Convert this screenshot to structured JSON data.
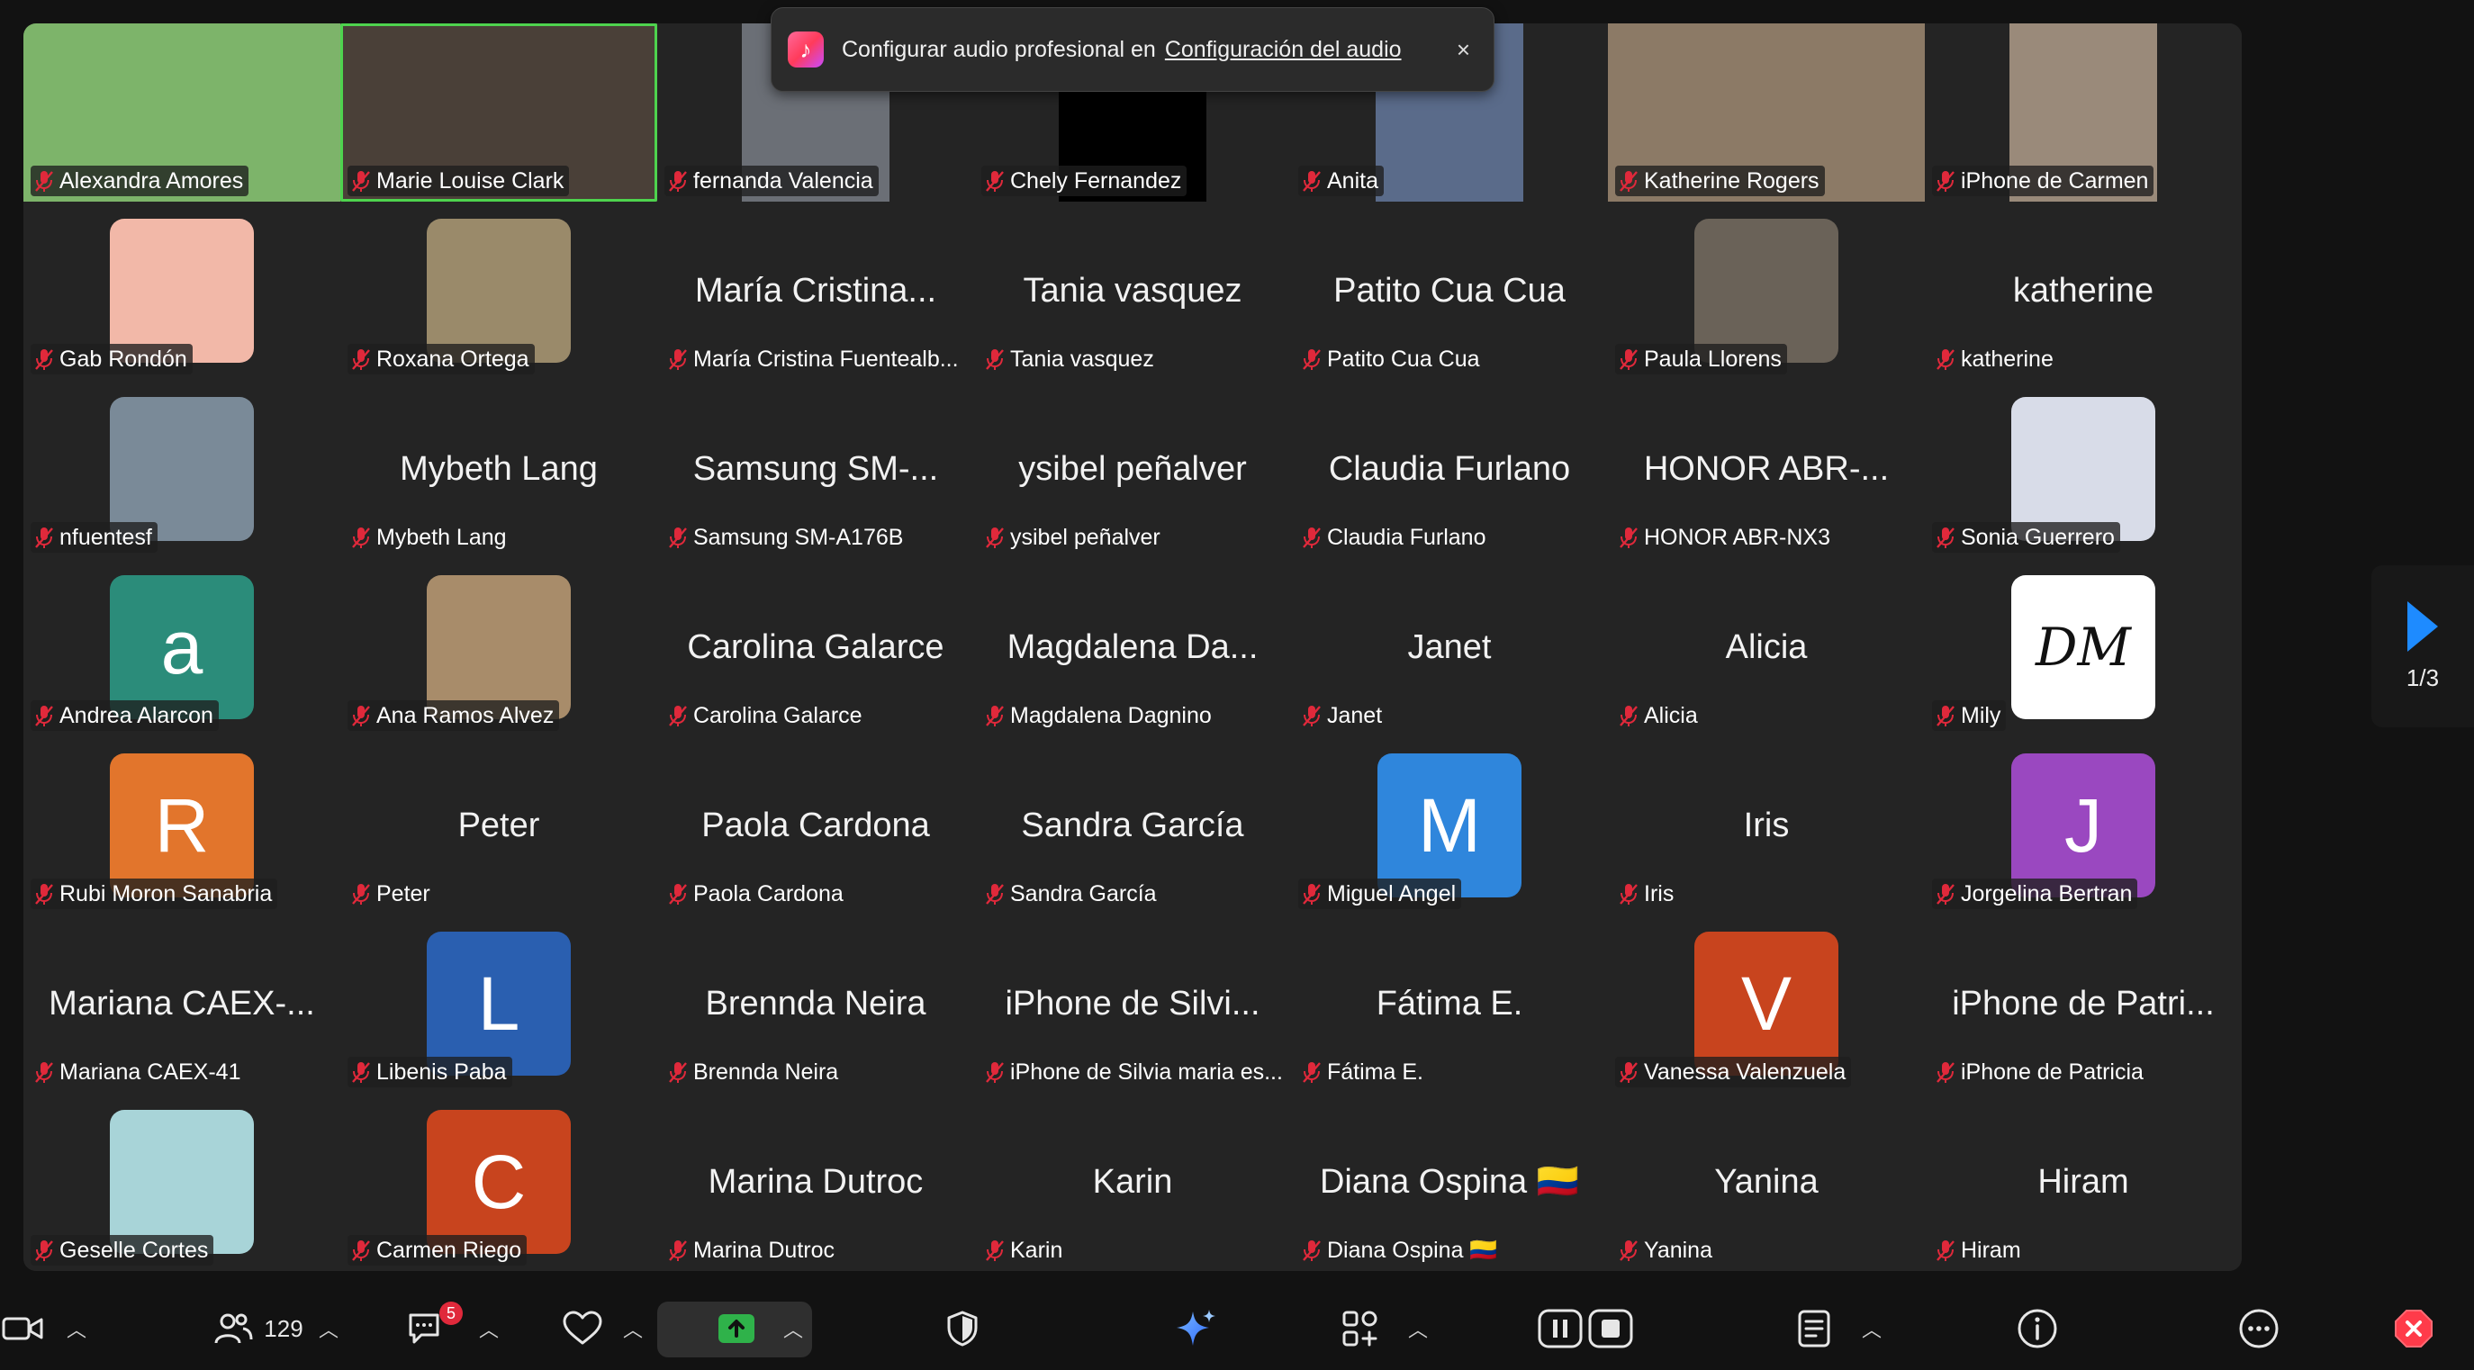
{
  "colors": {
    "background": "#121212",
    "grid": "#242424",
    "active_speaker_border": "#4ed34e",
    "mic_muted": "#e0293b",
    "accent_blue": "#1e8bff",
    "share_green": "#2fb24a"
  },
  "popup": {
    "text": "Configurar audio profesional en",
    "link": "Configuración del audio",
    "close": "×",
    "icon": "music-note-icon"
  },
  "pager": {
    "page": "1/3",
    "icon": "next-page-arrow-icon"
  },
  "participants": [
    {
      "label": "Alexandra Amores",
      "kind": "video",
      "bg": "#7db46a"
    },
    {
      "label": "Marie Louise Clark",
      "kind": "video",
      "bg": "#4a4038",
      "active": true
    },
    {
      "label": "fernanda Valencia",
      "kind": "video-small",
      "bg": "#6b6f76"
    },
    {
      "label": "Chely Fernandez",
      "kind": "video-small",
      "bg": "#000000"
    },
    {
      "label": "Anita",
      "kind": "video-small",
      "bg": "#5a6b8a"
    },
    {
      "label": "Katherine Rogers",
      "kind": "video",
      "bg": "#8c7a66"
    },
    {
      "label": "iPhone de Carmen",
      "kind": "video-small",
      "bg": "#9a8a7a"
    },
    {
      "label": "Gab Rondón",
      "kind": "avatar-photo",
      "bg": "#f2b8a8"
    },
    {
      "label": "Roxana Ortega",
      "kind": "avatar-photo",
      "bg": "#9a8a6a"
    },
    {
      "label": "María Cristina Fuentealb...",
      "kind": "name",
      "big": "María Cristina..."
    },
    {
      "label": "Tania vasquez",
      "kind": "name",
      "big": "Tania vasquez"
    },
    {
      "label": "Patito Cua Cua",
      "kind": "name",
      "big": "Patito Cua Cua"
    },
    {
      "label": "Paula Llorens",
      "kind": "avatar-photo",
      "bg": "#6a6258"
    },
    {
      "label": "katherine",
      "kind": "name",
      "big": "katherine"
    },
    {
      "label": "nfuentesf",
      "kind": "avatar-photo",
      "bg": "#7a8a98"
    },
    {
      "label": "Mybeth Lang",
      "kind": "name",
      "big": "Mybeth Lang"
    },
    {
      "label": "Samsung SM-A176B",
      "kind": "name",
      "big": "Samsung SM-..."
    },
    {
      "label": "ysibel peñalver",
      "kind": "name",
      "big": "ysibel peñalver"
    },
    {
      "label": "Claudia Furlano",
      "kind": "name",
      "big": "Claudia Furlano"
    },
    {
      "label": "HONOR ABR-NX3",
      "kind": "name",
      "big": "HONOR ABR-..."
    },
    {
      "label": "Sonia Guerrero",
      "kind": "avatar-photo",
      "bg": "#d8dce8"
    },
    {
      "label": "Andrea Alarcon",
      "kind": "avatar-letter",
      "letter": "a",
      "bg": "#2b8c7a"
    },
    {
      "label": "Ana Ramos Alvez",
      "kind": "avatar-photo",
      "bg": "#a88c6a"
    },
    {
      "label": "Carolina Galarce",
      "kind": "name",
      "big": "Carolina Galarce"
    },
    {
      "label": "Magdalena Dagnino",
      "kind": "name",
      "big": "Magdalena Da..."
    },
    {
      "label": "Janet",
      "kind": "name",
      "big": "Janet"
    },
    {
      "label": "Alicia",
      "kind": "name",
      "big": "Alicia"
    },
    {
      "label": "Mily",
      "kind": "avatar-logo",
      "letter": "DM",
      "bg": "#ffffff"
    },
    {
      "label": "Rubi Moron Sanabria",
      "kind": "avatar-letter",
      "letter": "R",
      "bg": "#e2752c"
    },
    {
      "label": "Peter",
      "kind": "name",
      "big": "Peter"
    },
    {
      "label": "Paola Cardona",
      "kind": "name",
      "big": "Paola Cardona"
    },
    {
      "label": "Sandra García",
      "kind": "name",
      "big": "Sandra García"
    },
    {
      "label": "Miguel Angel",
      "kind": "avatar-letter",
      "letter": "M",
      "bg": "#2f86dc"
    },
    {
      "label": "Iris",
      "kind": "name",
      "big": "Iris"
    },
    {
      "label": "Jorgelina Bertran",
      "kind": "avatar-letter",
      "letter": "J",
      "bg": "#9a48c0"
    },
    {
      "label": "Mariana CAEX-41",
      "kind": "name",
      "big": "Mariana CAEX-..."
    },
    {
      "label": "Libenis Paba",
      "kind": "avatar-letter",
      "letter": "L",
      "bg": "#2a5fb0"
    },
    {
      "label": "Brennda Neira",
      "kind": "name",
      "big": "Brennda Neira"
    },
    {
      "label": "iPhone de Silvia maria es...",
      "kind": "name",
      "big": "iPhone de Silvi..."
    },
    {
      "label": "Fátima E.",
      "kind": "name",
      "big": "Fátima E."
    },
    {
      "label": "Vanessa Valenzuela",
      "kind": "avatar-letter",
      "letter": "V",
      "bg": "#c8441e"
    },
    {
      "label": "iPhone de Patricia",
      "kind": "name",
      "big": "iPhone de Patri..."
    },
    {
      "label": "Geselle Cortes",
      "kind": "avatar-photo",
      "bg": "#a8d4d8"
    },
    {
      "label": "Carmen Riego",
      "kind": "avatar-letter",
      "letter": "C",
      "bg": "#c8441e"
    },
    {
      "label": "Marina Dutroc",
      "kind": "name",
      "big": "Marina Dutroc"
    },
    {
      "label": "Karin",
      "kind": "name",
      "big": "Karin"
    },
    {
      "label": "Diana Ospina 🇨🇴",
      "kind": "name",
      "big": "Diana Ospina 🇨🇴"
    },
    {
      "label": "Yanina",
      "kind": "name",
      "big": "Yanina"
    },
    {
      "label": "Hiram",
      "kind": "name",
      "big": "Hiram"
    }
  ],
  "toolbar": {
    "participants_count": "129",
    "chat_badge": "5",
    "icons": {
      "video": "video-camera-icon",
      "participants": "participants-icon",
      "chat": "chat-icon",
      "reactions": "heart-icon",
      "share": "share-screen-icon",
      "security": "shield-icon",
      "ai": "ai-sparkle-icon",
      "apps": "apps-icon",
      "record": "record-pause-stop-icon",
      "notes": "notes-icon",
      "info": "info-icon",
      "more": "more-icon",
      "leave": "leave-icon"
    }
  }
}
